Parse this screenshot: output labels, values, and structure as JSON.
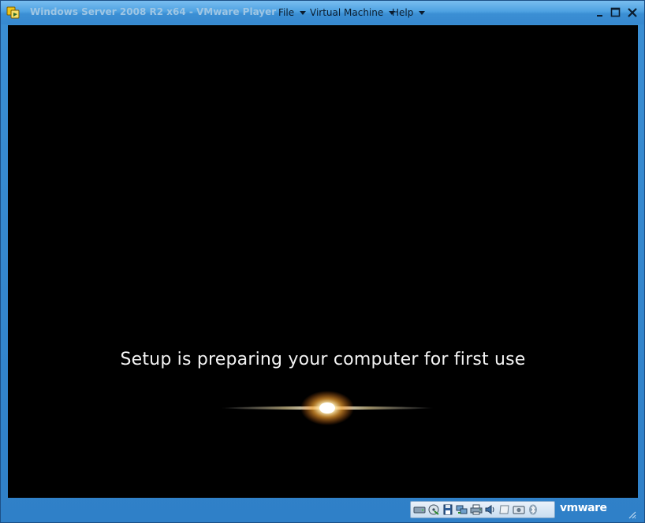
{
  "window": {
    "title": "Windows Server 2008 R2 x64 - VMware Player"
  },
  "menu": {
    "file": "File",
    "virtual_machine": "Virtual Machine",
    "help": "Help"
  },
  "guest": {
    "message": "Setup is preparing your computer for first use"
  },
  "statusbar": {
    "logo": "vmware"
  },
  "icons": {
    "app": "vmware-player-icon",
    "minimize": "minimize-icon",
    "maximize": "maximize-icon",
    "close": "close-icon",
    "devices": [
      "hard-disk-icon",
      "cd-dvd-icon",
      "floppy-icon",
      "network-adapter-icon",
      "printer-icon",
      "sound-card-icon",
      "display-icon",
      "camera-icon",
      "bluetooth-icon"
    ]
  },
  "colors": {
    "frame": "#3688cf",
    "viewport": "#000000",
    "text": "#f2f2f2",
    "title_text": "#9fc6e4"
  }
}
